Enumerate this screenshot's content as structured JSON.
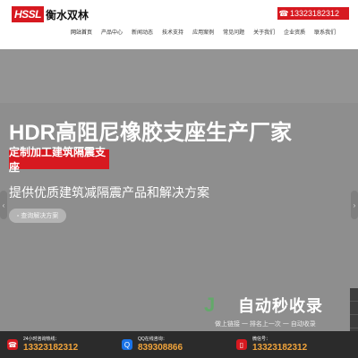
{
  "header": {
    "logo_mark": "HSSL",
    "logo_text": "衡水双林",
    "phone_icon": "phone-icon",
    "phone": "13323182312"
  },
  "nav": {
    "items": [
      "网站首页",
      "产品中心",
      "新闻动态",
      "技术支持",
      "应用案例",
      "常见问题",
      "关于我们",
      "企业资质",
      "联系我们"
    ]
  },
  "hero": {
    "title": "HDR高阻尼橡胶支座生产厂家",
    "tagline": "定制加工建筑隔震支座",
    "subtitle": "提供优质建筑减隔震产品和解决方案",
    "cta_label": "查询解决方案",
    "cta_icon": "search-icon",
    "prev_icon": "chevron-left-icon",
    "next_icon": "chevron-right-icon",
    "dots": 3
  },
  "watermark": {
    "logo_mark": "J",
    "title": "自动秒收录",
    "subtitle": "做上链接 一 排名上一次 一 自动收录"
  },
  "contact_bar": {
    "items": [
      {
        "icon": "phone-icon",
        "label": "24小时咨询热线：",
        "value": "13323182312"
      },
      {
        "icon": "qq-icon",
        "label": "QQ在线咨询：",
        "value": "839308866"
      },
      {
        "icon": "mobile-icon",
        "label": "微信号：",
        "value": "13323182312"
      }
    ]
  },
  "colors": {
    "accent": "#d71920",
    "hero_bg": "#8e8e8e",
    "bar_bg": "#2b2b2b",
    "value_text": "#f1a43b"
  }
}
